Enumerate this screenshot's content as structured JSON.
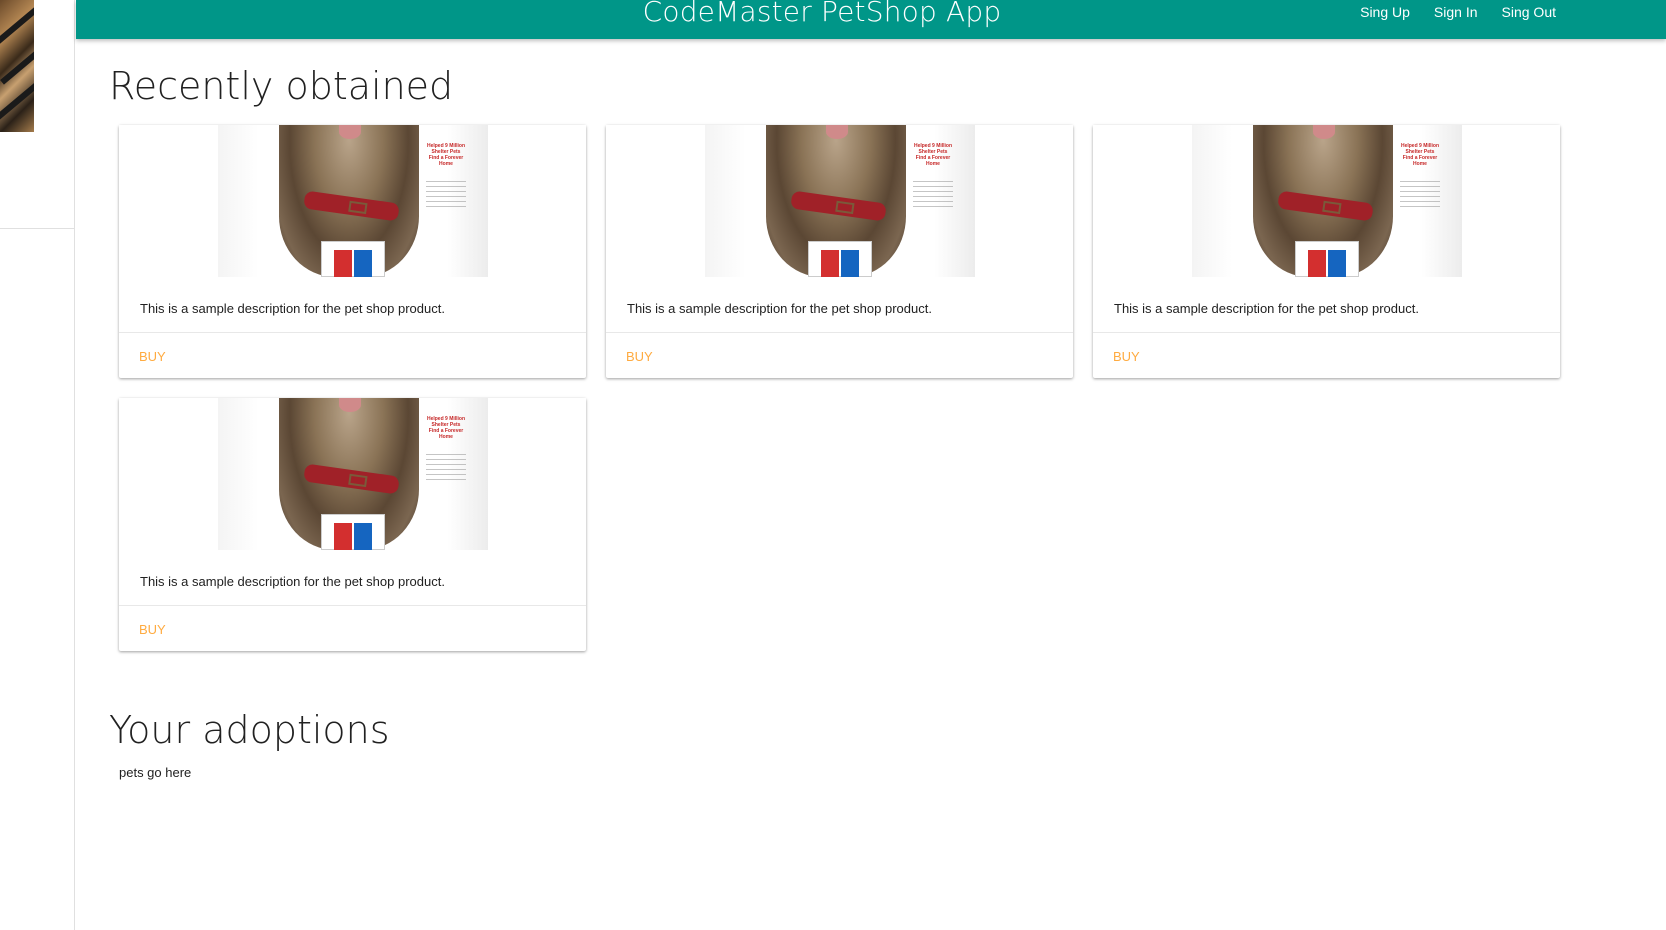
{
  "app": {
    "title": "CodeMaster PetShop App"
  },
  "nav": {
    "items": [
      {
        "label": "Sing Up"
      },
      {
        "label": "Sign In"
      },
      {
        "label": "Sing Out"
      }
    ]
  },
  "recent": {
    "title": "Recently obtained",
    "products": [
      {
        "description": "This is a sample description for the pet shop product.",
        "action": "BUY"
      },
      {
        "description": "This is a sample description for the pet shop product.",
        "action": "BUY"
      },
      {
        "description": "This is a sample description for the pet shop product.",
        "action": "BUY"
      },
      {
        "description": "This is a sample description for the pet shop product.",
        "action": "BUY"
      }
    ],
    "bag_text": "Helped 9 Million Shelter Pets Find a Forever Home"
  },
  "adoptions": {
    "title": "Your adoptions",
    "placeholder": "pets go here"
  },
  "colors": {
    "app_bar": "#009688",
    "accent": "#ffab40"
  }
}
